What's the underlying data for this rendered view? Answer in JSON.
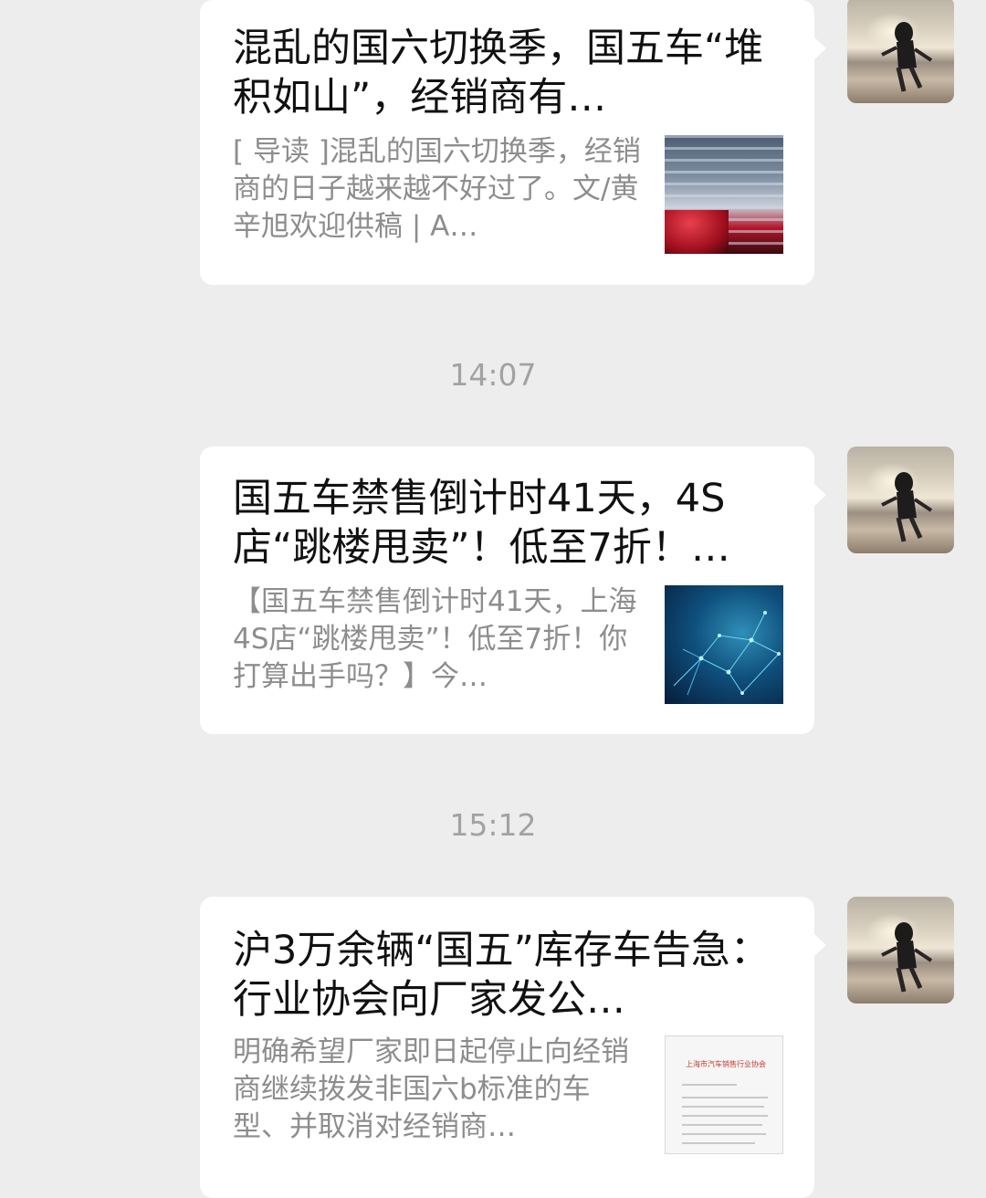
{
  "messages": [
    {
      "title": "混乱的国六切换季，国五车“堆积如山”，经销商有…",
      "summary": "[ 导读 ]混乱的国六切换季，经销商的日子越来越不好过了。文/黄辛旭欢迎供稿 | A…",
      "thumbnail": "cars-parking-lot-image"
    },
    {
      "time": "14:07",
      "title": "国五车禁售倒计时41天，4S店“跳楼甩卖”！低至7折！…",
      "summary": "【国五车禁售倒计时41天，上海4S店“跳楼甩卖”！低至7折！你打算出手吗？】今…",
      "thumbnail": "blue-network-image"
    },
    {
      "time": "15:12",
      "title": "沪3万余辆“国五”库存车告急：行业协会向厂家发公…",
      "summary": "明确希望厂家即日起停止向经销商继续拨发非国六b标准的车型、并取消对经销商…",
      "thumbnail": "document-image",
      "thumbnail_text": "上海市汽车销售行业协会"
    }
  ]
}
